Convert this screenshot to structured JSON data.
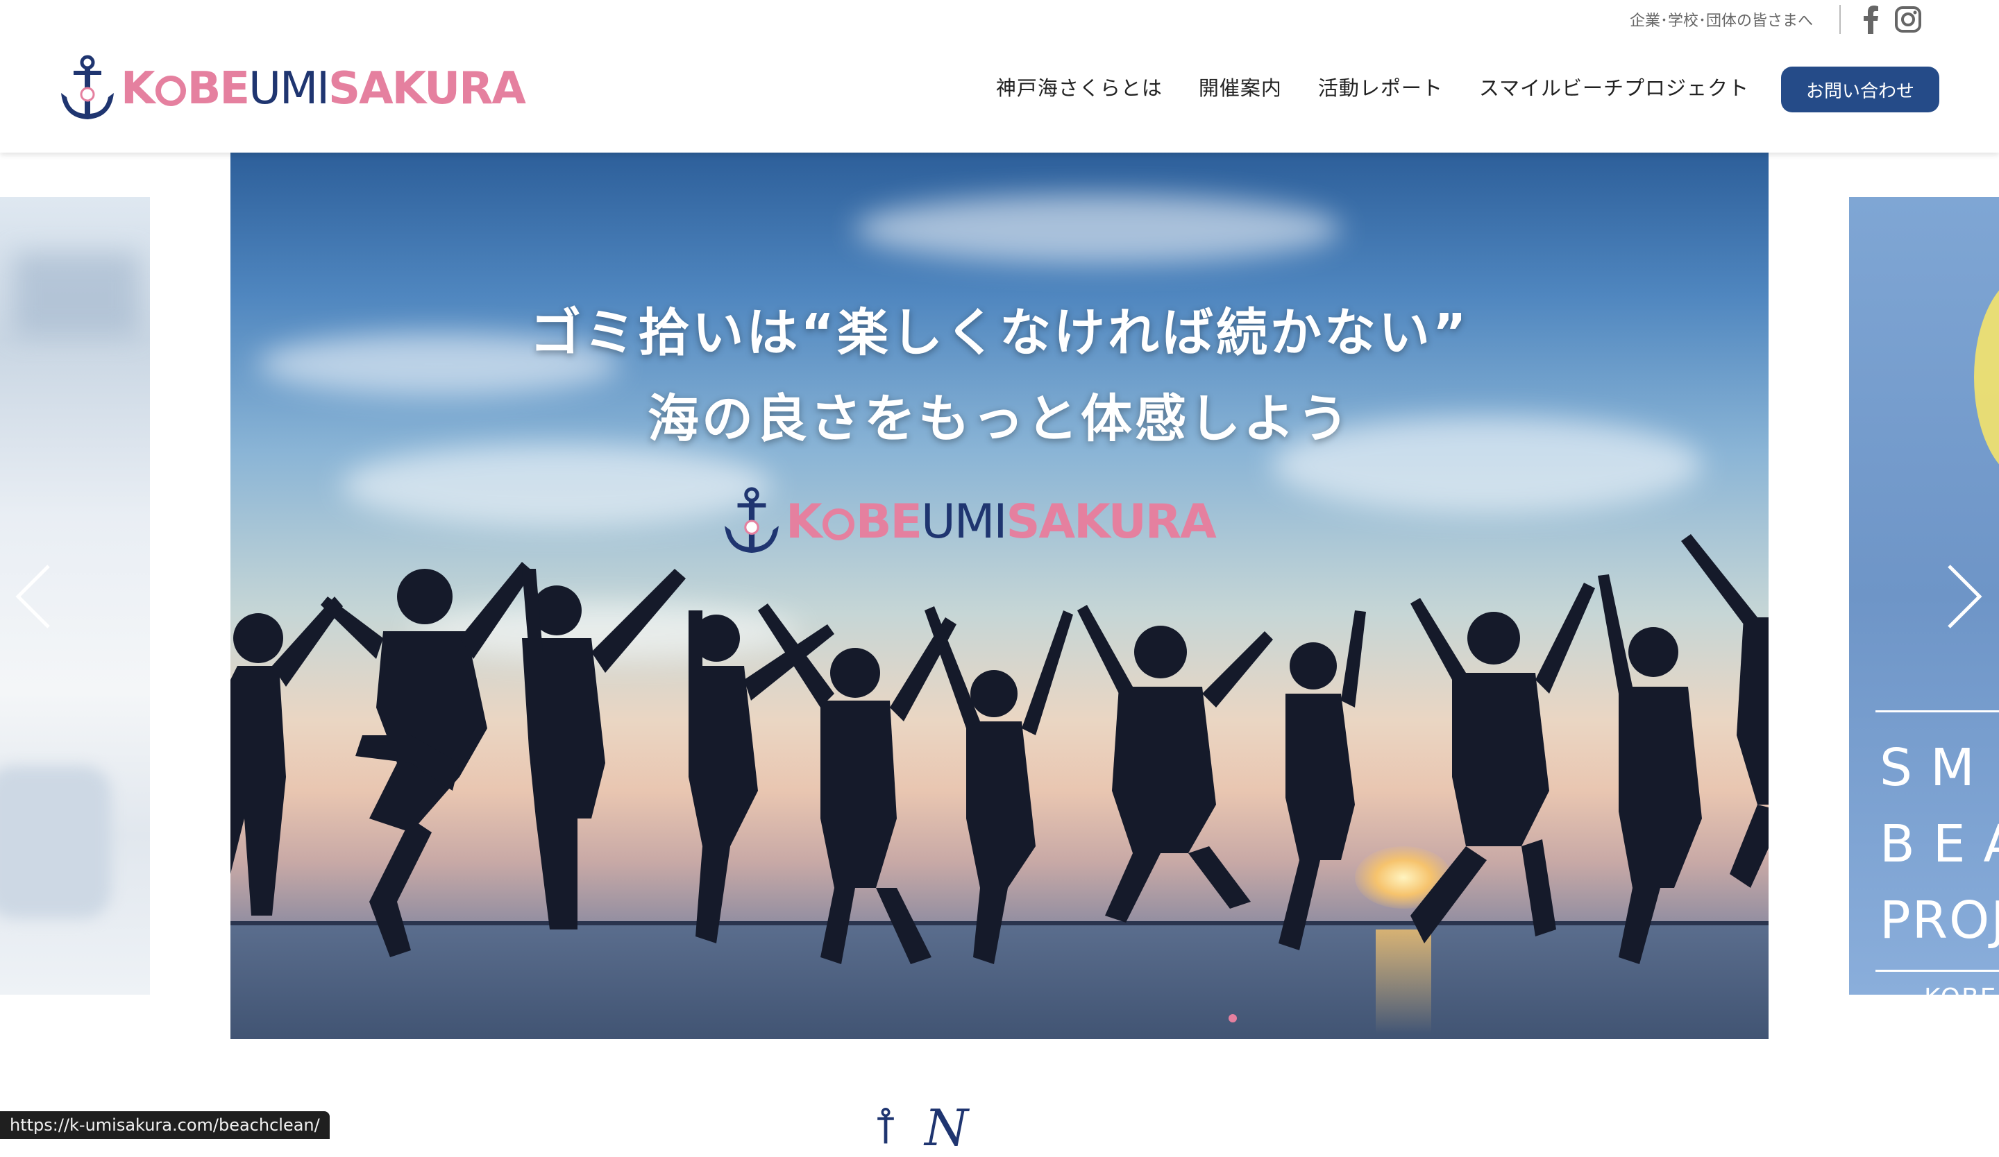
{
  "header": {
    "utility_link": "企業･学校･団体の皆さまへ",
    "logo": {
      "prefix": "K",
      "middle": "BE",
      "rest_navy": "UMI",
      "rest_pink": "SAKURA"
    },
    "nav": [
      {
        "label": "神戸海さくらとは"
      },
      {
        "label": "開催案内"
      },
      {
        "label": "活動レポート"
      },
      {
        "label": "スマイルビーチプロジェクト"
      }
    ],
    "contact_label": "お問い合わせ",
    "social": [
      "facebook-icon",
      "instagram-icon"
    ]
  },
  "slider": {
    "headline_line1": "ゴミ拾いは“楽しくなければ続かない”",
    "headline_line2": "海の良さをもっと体感しよう",
    "next_slide": {
      "row1": "SM",
      "row2": "BEA",
      "row3": "PROJ",
      "footer": "KOBE"
    },
    "active_dot": 1,
    "dots": 1
  },
  "section": {
    "title": "N"
  },
  "status_bar": {
    "url": "https://k-umisakura.com/beachclean/"
  },
  "colors": {
    "brand_navy": "#1f3570",
    "brand_pink": "#e5809f",
    "button": "#254b88"
  }
}
